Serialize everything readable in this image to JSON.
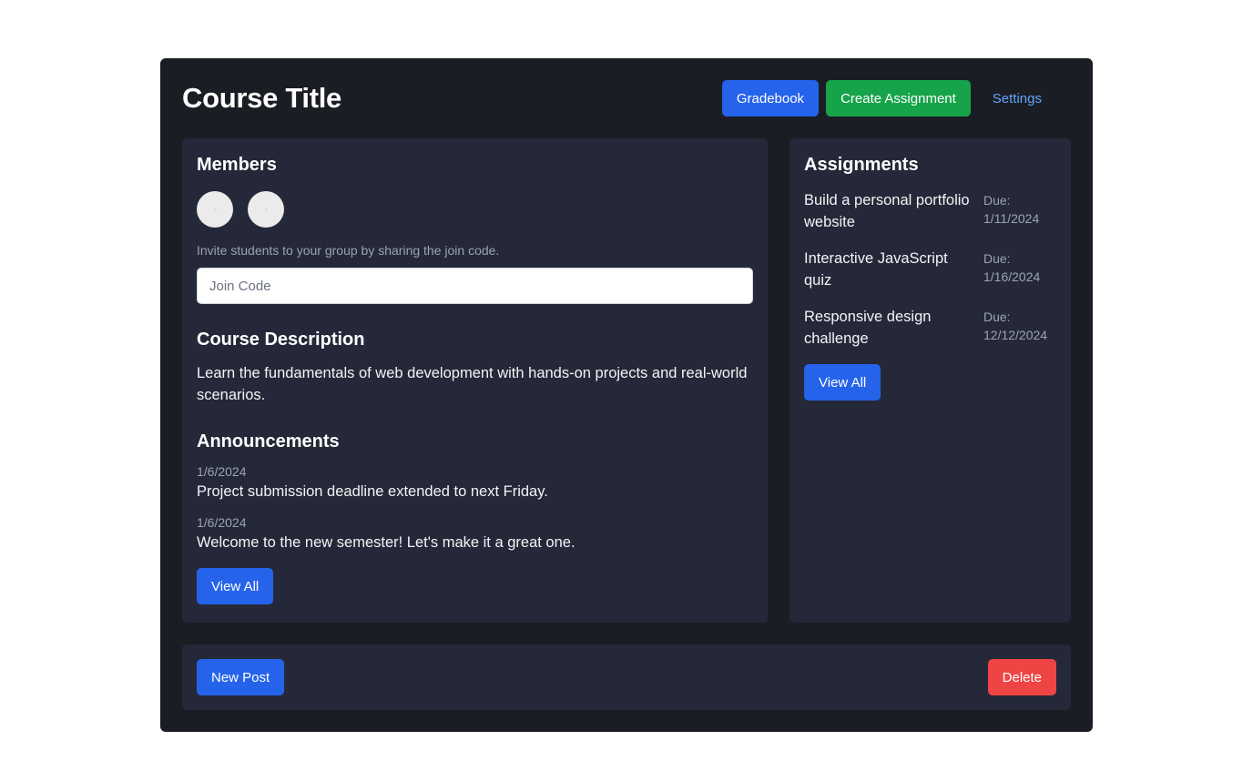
{
  "header": {
    "title": "Course Title",
    "gradebook_label": "Gradebook",
    "create_assignment_label": "Create Assignment",
    "settings_label": "Settings"
  },
  "members": {
    "title": "Members",
    "avatar_count": 2,
    "invite_hint": "Invite students to your group by sharing the join code.",
    "join_code_placeholder": "Join Code",
    "join_code_value": ""
  },
  "description": {
    "title": "Course Description",
    "text": "Learn the fundamentals of web development with hands-on projects and real-world scenarios."
  },
  "announcements": {
    "title": "Announcements",
    "items": [
      {
        "date": "1/6/2024",
        "text": "Project submission deadline extended to next Friday."
      },
      {
        "date": "1/6/2024",
        "text": "Welcome to the new semester! Let's make it a great one."
      }
    ],
    "view_all_label": "View All"
  },
  "assignments": {
    "title": "Assignments",
    "due_prefix": "Due:",
    "items": [
      {
        "title": "Build a personal portfolio website",
        "due": "1/11/2024"
      },
      {
        "title": "Interactive JavaScript quiz",
        "due": "1/16/2024"
      },
      {
        "title": "Responsive design challenge",
        "due": "12/12/2024"
      }
    ],
    "view_all_label": "View All"
  },
  "footer": {
    "new_post_label": "New Post",
    "delete_label": "Delete"
  },
  "colors": {
    "page_background": "#ffffff",
    "window_background": "#1b1d24",
    "panel_background": "#252838",
    "primary_blue": "#2563eb",
    "success_green": "#16a34a",
    "danger_red": "#ef4444",
    "link_blue": "#60a5fa",
    "muted_text": "#9ca3af"
  }
}
